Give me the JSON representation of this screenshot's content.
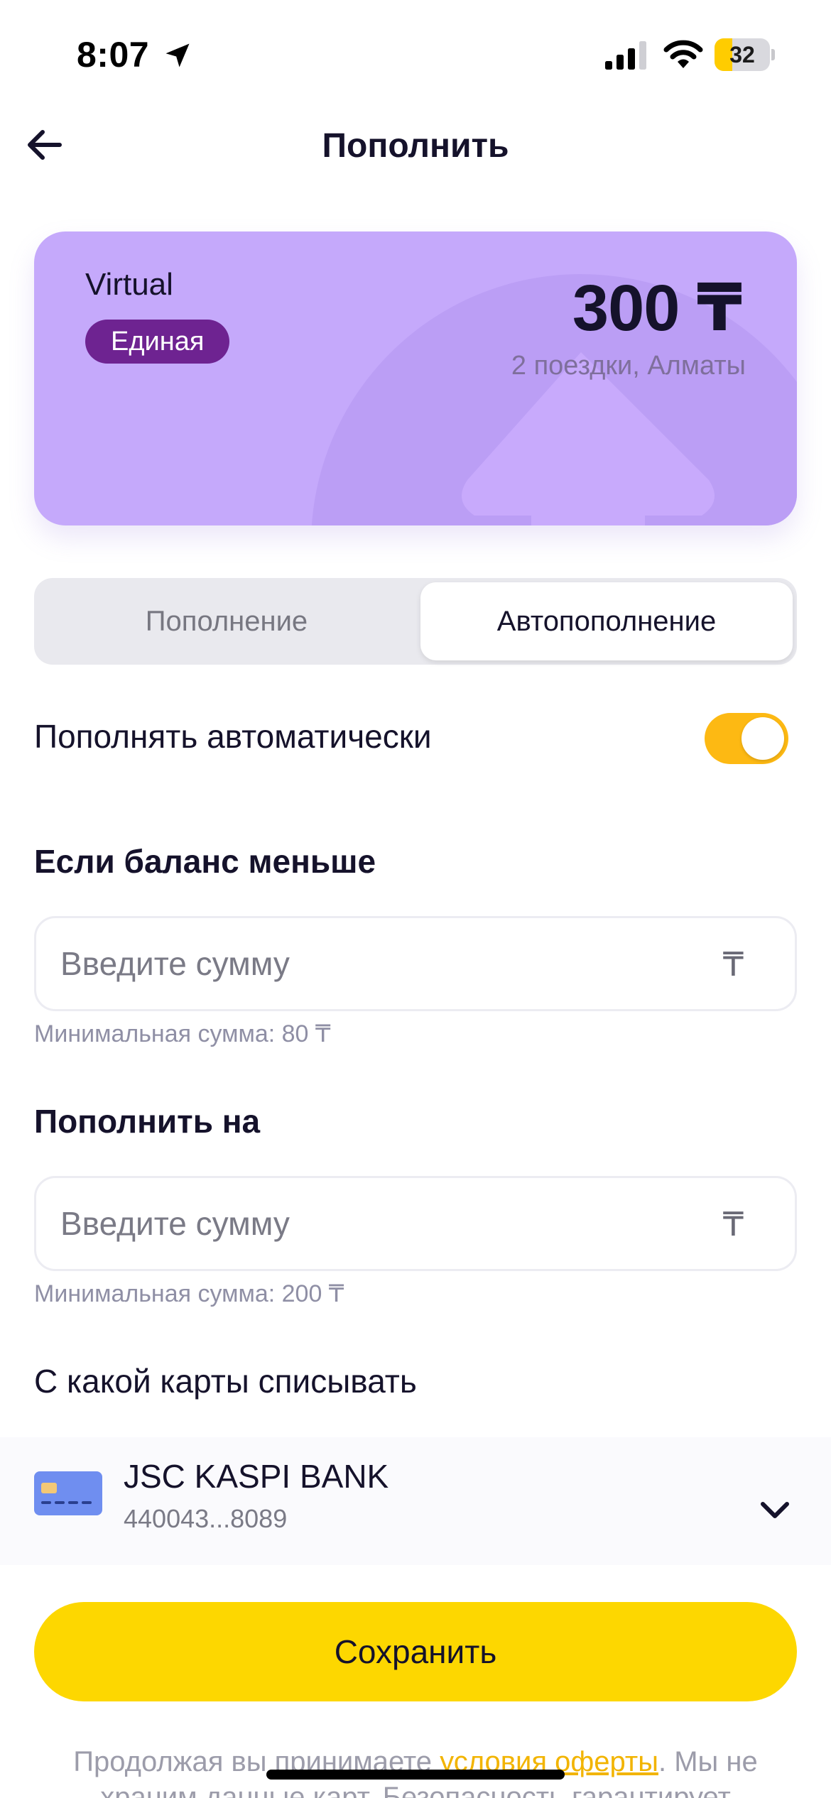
{
  "status_bar": {
    "time": "8:07",
    "battery_level": "32",
    "battery_fraction": 0.32,
    "icons": [
      "location-arrow-icon",
      "signal-icon",
      "wifi-icon",
      "battery-icon"
    ]
  },
  "header": {
    "title": "Пополнить",
    "back_icon": "arrow-left-icon"
  },
  "card": {
    "type": "Virtual",
    "badge": "Единая",
    "amount": "300 ₸",
    "subtitle": "2 поездки, Алматы"
  },
  "tabs": [
    {
      "label": "Пополнение",
      "selected": false
    },
    {
      "label": "Автопополнение",
      "selected": true
    }
  ],
  "auto_topup": {
    "label": "Пополнять автоматически",
    "enabled": true
  },
  "threshold": {
    "title": "Если баланс меньше",
    "placeholder": "Введите сумму",
    "value": "",
    "currency": "₸",
    "hint": "Минимальная сумма: 80 ₸"
  },
  "topup_amount": {
    "title": "Пополнить на",
    "placeholder": "Введите сумму",
    "value": "",
    "currency": "₸",
    "hint": "Минимальная сумма: 200 ₸"
  },
  "payment": {
    "title": "С какой карты списывать",
    "bank": "JSC KASPI BANK",
    "number": "440043...8089"
  },
  "save_label": "Сохранить",
  "legal": {
    "prefix": "Продолжая вы принимаете ",
    "link": "условия оферты",
    "suffix": ". Мы не храним данные карт. Безопасность гарантирует"
  },
  "colors": {
    "accent_yellow": "#fdd700",
    "toggle_on": "#fdb913",
    "card_purple": "#c5a9fb",
    "badge_purple": "#6e2391",
    "text_dark": "#15122b"
  }
}
